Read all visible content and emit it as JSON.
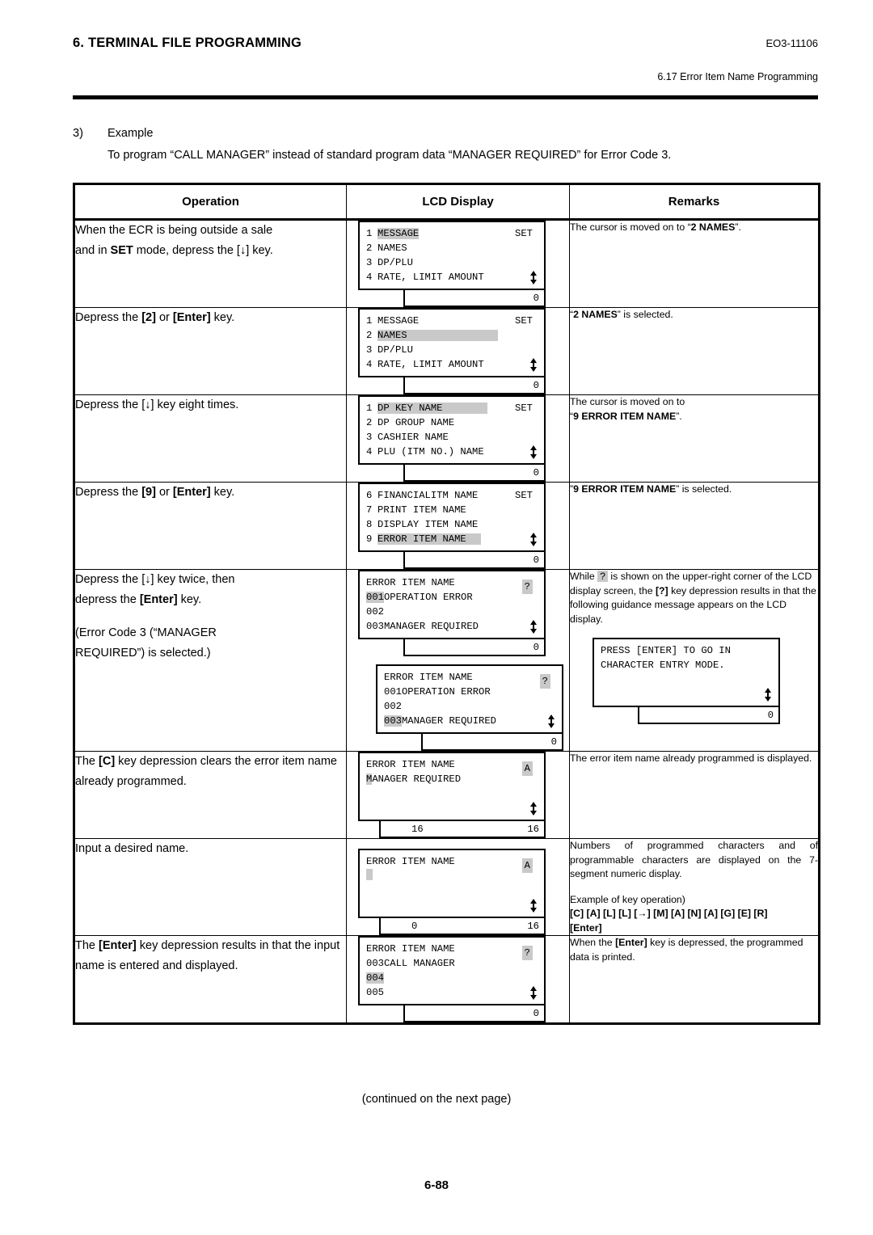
{
  "header": {
    "title": "6. TERMINAL FILE PROGRAMMING",
    "doc_code": "EO3-11106",
    "section": "6.17 Error Item Name Programming"
  },
  "intro": {
    "number": "3)",
    "label": "Example",
    "description": "To program “CALL MANAGER” instead of standard program data “MANAGER REQUIRED” for Error Code 3."
  },
  "table": {
    "columns": [
      "Operation",
      "LCD Display",
      "Remarks"
    ],
    "rows": [
      {
        "operation_line1": "When the ECR is being outside a sale",
        "operation_line2_a": "and in ",
        "operation_line2_b": "SET",
        "operation_line2_c": " mode, depress the [",
        "operation_line2_key": "↓",
        "operation_line2_d": "] key.",
        "lcd": {
          "lines": [
            {
              "index": "1",
              "text": "MESSAGE",
              "highlight": true
            },
            {
              "index": "2",
              "text": "NAMES",
              "highlight": false
            },
            {
              "index": "3",
              "text": "DP/PLU",
              "highlight": false
            },
            {
              "index": "4",
              "text": "RATE, LIMIT AMOUNT",
              "highlight": false
            }
          ],
          "corner": "SET",
          "numeric_right": "0"
        },
        "remarks_pre": "The cursor is moved on to “",
        "remarks_bold": "2 NAMES",
        "remarks_post": "”."
      },
      {
        "operation_pre": "Depress the ",
        "operation_k1": "[2]",
        "operation_mid": " or ",
        "operation_k2": "[Enter]",
        "operation_post": " key.",
        "lcd": {
          "lines": [
            {
              "index": "1",
              "text": "MESSAGE",
              "highlight": false
            },
            {
              "index": "2",
              "text": "NAMES",
              "highlight": true
            },
            {
              "index": "3",
              "text": "DP/PLU",
              "highlight": false
            },
            {
              "index": "4",
              "text": "RATE, LIMIT AMOUNT",
              "highlight": false
            }
          ],
          "corner": "SET",
          "numeric_right": "0"
        },
        "remarks_pre": "“",
        "remarks_bold": "2 NAMES",
        "remarks_post": "” is selected."
      },
      {
        "operation_pre": "Depress the [",
        "operation_key": "↓",
        "operation_post": "] key eight times.",
        "lcd": {
          "lines": [
            {
              "index": "1",
              "text": "DP KEY NAME",
              "highlight": true
            },
            {
              "index": "2",
              "text": "DP GROUP NAME",
              "highlight": false
            },
            {
              "index": "3",
              "text": "CASHIER NAME",
              "highlight": false
            },
            {
              "index": "4",
              "text": "PLU (ITM NO.) NAME",
              "highlight": false
            }
          ],
          "corner": "SET",
          "numeric_right": "0"
        },
        "remarks_line1": "The cursor is moved on to",
        "remarks_pre2": "“",
        "remarks_bold": "9 ERROR ITEM NAME",
        "remarks_post2": "”."
      },
      {
        "operation_pre": "Depress the ",
        "operation_k1": "[9]",
        "operation_mid": " or ",
        "operation_k2": "[Enter]",
        "operation_post": " key.",
        "lcd": {
          "lines": [
            {
              "index": "6",
              "text": "FINANCIALITM NAME",
              "highlight": false
            },
            {
              "index": "7",
              "text": "PRINT ITEM NAME",
              "highlight": false
            },
            {
              "index": "8",
              "text": "DISPLAY ITEM NAME",
              "highlight": false
            },
            {
              "index": "9",
              "text": "ERROR ITEM NAME",
              "highlight": true
            }
          ],
          "corner": "SET",
          "numeric_right": "0"
        },
        "remarks_pre": "”",
        "remarks_bold": "9 ERROR ITEM NAME",
        "remarks_post": "” is selected."
      },
      {
        "operation_line1_pre": "Depress the [",
        "operation_line1_key": "↓",
        "operation_line1_post": "] key twice, then",
        "operation_line2_pre": "depress the ",
        "operation_line2_k": "[Enter]",
        "operation_line2_post": " key.",
        "operation_line3": "(Error Code 3 (“MANAGER",
        "operation_line4": "REQUIRED”) is selected.)",
        "lcd_a": {
          "title": "ERROR ITEM NAME",
          "corner": "?",
          "lines": [
            {
              "code": "001",
              "text": "OPERATION ERROR",
              "code_highlight": true
            },
            {
              "code": "002",
              "text": "",
              "code_highlight": false
            },
            {
              "code": "003",
              "text": "MANAGER REQUIRED",
              "code_highlight": false
            }
          ],
          "numeric_right": "0"
        },
        "lcd_b": {
          "title": "ERROR ITEM NAME",
          "corner": "?",
          "lines": [
            {
              "code": "001",
              "text": "OPERATION ERROR",
              "code_highlight": false
            },
            {
              "code": "002",
              "text": "",
              "code_highlight": false
            },
            {
              "code": "003",
              "text": "MANAGER REQUIRED",
              "code_highlight": true
            }
          ],
          "numeric_right": "0"
        },
        "remarks_p1": "While ",
        "remarks_mark": "?",
        "remarks_p2": " is shown on the upper-right corner of the LCD display screen, the ",
        "remarks_key": "[?]",
        "remarks_p3": " key depression results in that the following guidance message appears on the LCD display.",
        "guide": {
          "line1": "PRESS [ENTER] TO GO IN",
          "line2": "CHARACTER ENTRY MODE.",
          "numeric_right": "0"
        }
      },
      {
        "operation_pre": "The ",
        "operation_k": "[C]",
        "operation_post": " key depression clears the error item name already programmed.",
        "lcd": {
          "title": "ERROR ITEM NAME",
          "corner": "A",
          "line2_head": "M",
          "line2_rest": "ANAGER REQUIRED",
          "numeric_left": "16",
          "numeric_right": "16"
        },
        "remarks": "The error item name already programmed is displayed."
      },
      {
        "operation": "Input a desired name.",
        "lcd": {
          "title": "ERROR ITEM NAME",
          "corner": "A",
          "numeric_left": "0",
          "numeric_right": "16"
        },
        "remarks_p1": "Numbers of programmed characters and of programmable characters are displayed on the 7-segment numeric display.",
        "remarks_p2": "Example of key operation)",
        "remarks_keys": "[C] [A] [L] [L] [→] [M] [A] [N] [A] [G] [E] [R]",
        "remarks_keys2": "[Enter]"
      },
      {
        "operation_pre": "The ",
        "operation_k": "[Enter]",
        "operation_post": " key depression results in that the input name is entered and displayed.",
        "lcd": {
          "title": "ERROR ITEM NAME",
          "corner": "?",
          "lines": [
            {
              "code": "003",
              "text": "CALL MANAGER",
              "code_highlight": false
            },
            {
              "code": "004",
              "text": "",
              "code_highlight": true
            },
            {
              "code": "005",
              "text": "",
              "code_highlight": false
            }
          ],
          "numeric_right": "0"
        },
        "remarks_pre": "When the ",
        "remarks_k": "[Enter]",
        "remarks_post": " key is depressed, the programmed data is printed."
      }
    ]
  },
  "footer": {
    "continued": "(continued on the next page)",
    "page_number": "6-88"
  }
}
